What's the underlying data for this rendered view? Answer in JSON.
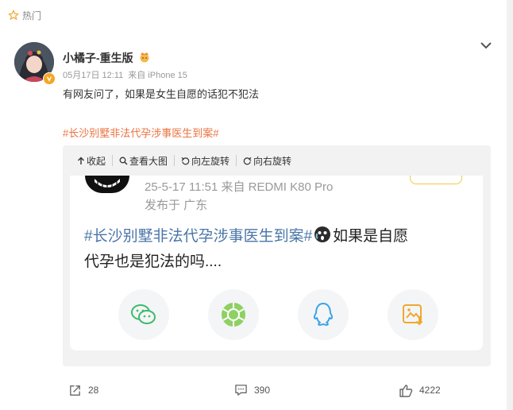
{
  "header": {
    "section_label": "热门"
  },
  "post": {
    "username": "小橘子-重生版",
    "date": "05月17日 12:11",
    "source": "来自 iPhone 15",
    "text": "有网友问了，如果是女生自愿的话犯不犯法",
    "topic": "#长沙别墅非法代孕涉事医生到案#"
  },
  "media_toolbar": {
    "collapse": "收起",
    "view_large": "查看大图",
    "rotate_left": "向左旋转",
    "rotate_right": "向右旋转"
  },
  "screenshot": {
    "meta": "25-5-17 11:51  来自 REDMI K80 Pro",
    "location": "发布于 广东",
    "topic": "#长沙别墅非法代孕涉事医生到案#",
    "text_line1": "如果是自愿",
    "text_line2": "代孕也是犯法的吗....",
    "share_icons": [
      "wechat-icon",
      "moments-icon",
      "qq-icon",
      "save-image-icon"
    ]
  },
  "actions": {
    "reposts": "28",
    "comments": "390",
    "likes": "4222"
  },
  "colors": {
    "topic": "#eb7340",
    "screenshot_topic": "#4a75a8",
    "wechat": "#3dbb6b",
    "qq": "#3aa4e8",
    "save": "#f0a830"
  }
}
